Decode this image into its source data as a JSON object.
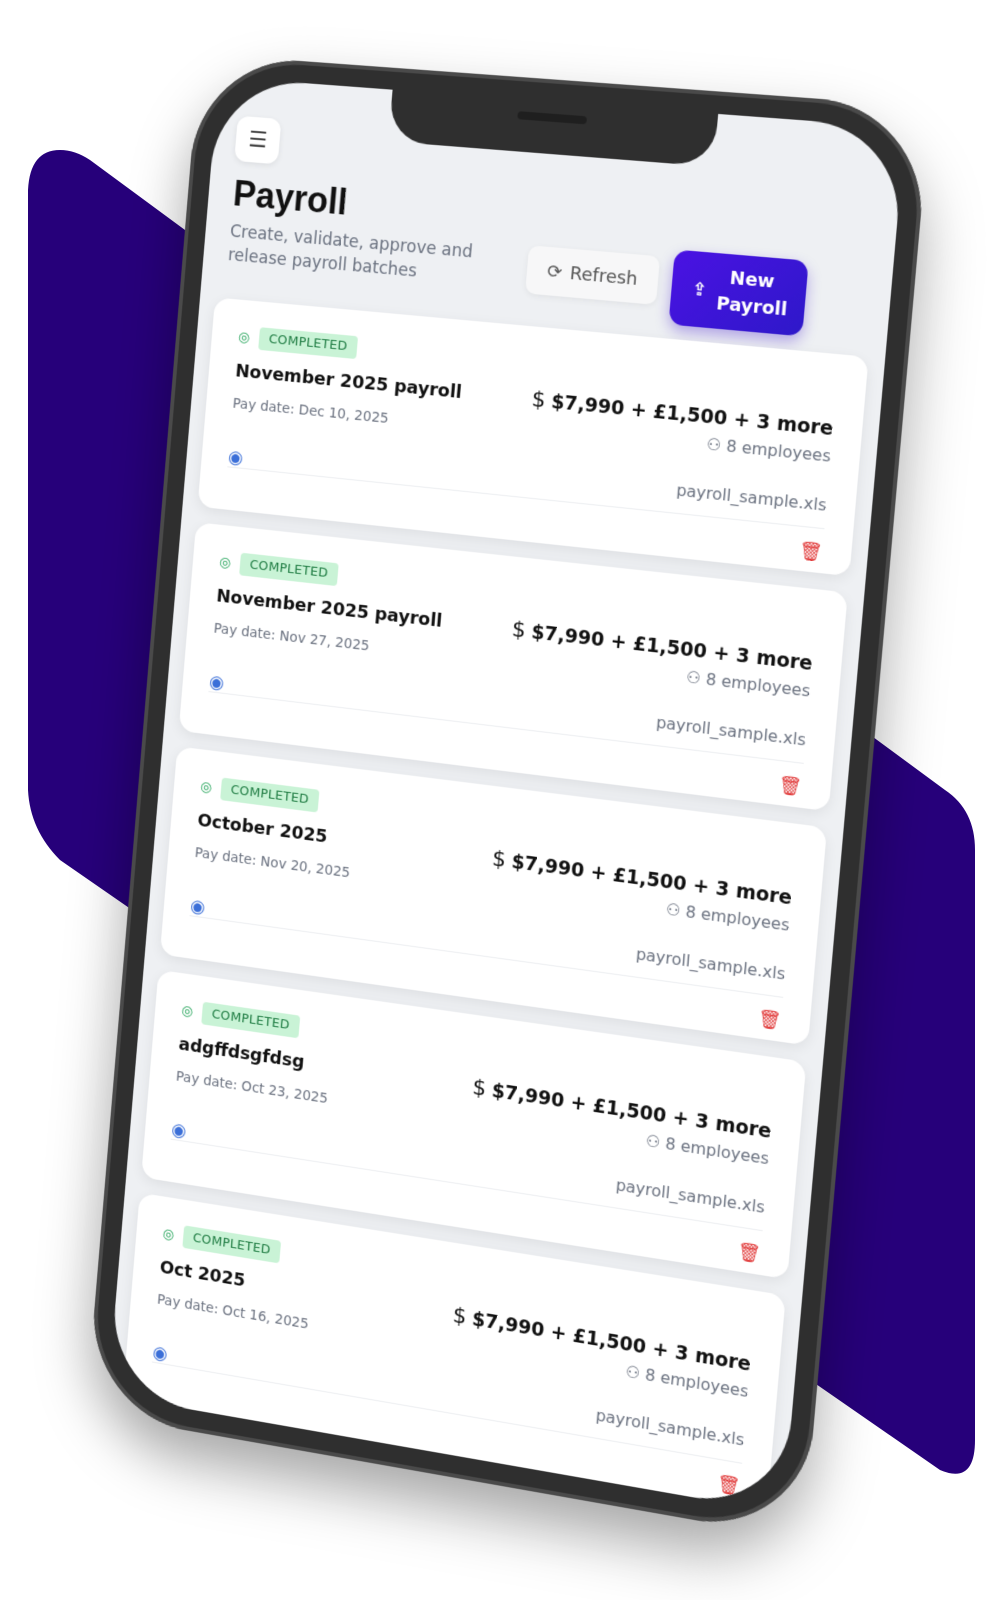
{
  "colors": {
    "background_shape": "#26007a",
    "primary_button": "#3b15d8",
    "badge_bg": "#c9f3d6",
    "badge_text": "#1c7a40",
    "delete_icon": "#e03434",
    "view_icon": "#3b6fd8"
  },
  "header": {
    "title": "Payroll",
    "subtitle": "Create, validate, approve and release payroll batches",
    "refresh_label": "Refresh",
    "new_label": "New Payroll"
  },
  "icons": {
    "menu": "menu-icon",
    "refresh": "refresh-icon",
    "upload": "upload-icon",
    "check": "check-circle-icon",
    "users": "users-icon",
    "view": "eye-icon",
    "delete": "trash-icon"
  },
  "payrolls": [
    {
      "status": "COMPLETED",
      "title": "November 2025 payroll",
      "pay_date": "Pay date: Dec 10, 2025",
      "currency_symbol": "$",
      "amount": "$7,990 + £1,500 + 3 more",
      "employees": "8 employees",
      "file": "payroll_sample.xls"
    },
    {
      "status": "COMPLETED",
      "title": "November 2025 payroll",
      "pay_date": "Pay date: Nov 27, 2025",
      "currency_symbol": "$",
      "amount": "$7,990 + £1,500 + 3 more",
      "employees": "8 employees",
      "file": "payroll_sample.xls"
    },
    {
      "status": "COMPLETED",
      "title": "October 2025",
      "pay_date": "Pay date: Nov 20, 2025",
      "currency_symbol": "$",
      "amount": "$7,990 + £1,500 + 3 more",
      "employees": "8 employees",
      "file": "payroll_sample.xls"
    },
    {
      "status": "COMPLETED",
      "title": "adgffdsgfdsg",
      "pay_date": "Pay date: Oct 23, 2025",
      "currency_symbol": "$",
      "amount": "$7,990 + £1,500 + 3 more",
      "employees": "8 employees",
      "file": "payroll_sample.xls"
    },
    {
      "status": "COMPLETED",
      "title": "Oct 2025",
      "pay_date": "Pay date: Oct 16, 2025",
      "currency_symbol": "$",
      "amount": "$7,990 + £1,500 + 3 more",
      "employees": "8 employees",
      "file": "payroll_sample.xls"
    }
  ]
}
